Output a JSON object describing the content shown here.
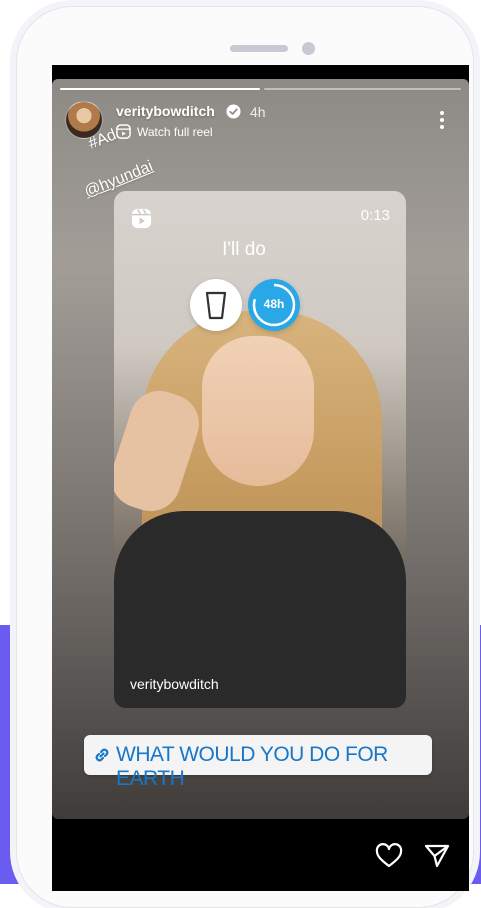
{
  "story": {
    "username": "veritybowditch",
    "time_ago": "4h",
    "reel_link_label": "Watch full reel",
    "hashtag": "#Ad",
    "mention": "@hyundai",
    "progress_segments": 2,
    "progress_active_fraction": 0.5
  },
  "reel": {
    "duration": "0:13",
    "caption": "I'll do",
    "timer_label": "48h",
    "author": "veritybowditch"
  },
  "link_sticker": {
    "text": "WHAT WOULD YOU DO FOR EARTH"
  },
  "actions": {
    "like_icon": "heart-icon",
    "share_icon": "send-icon"
  },
  "colors": {
    "link_text": "#1877c8",
    "timer_sticker": "#2aa7e6",
    "accent_band": "#6a5cf0"
  }
}
